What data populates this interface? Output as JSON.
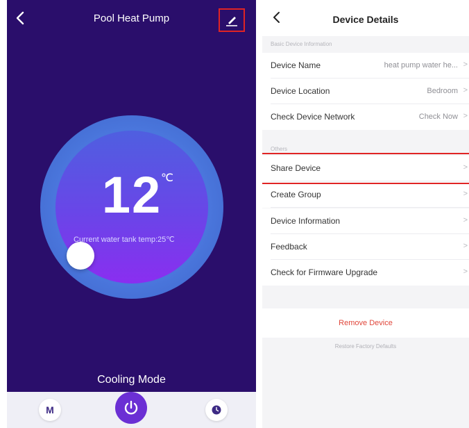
{
  "left": {
    "title": "Pool Heat Pump",
    "back_icon": "chevron-left-icon",
    "edit_icon": "pencil-icon",
    "temperature": "12",
    "unit": "℃",
    "current_temp_text": "Current water tank temp:25℃",
    "mode": "Cooling Mode",
    "mode_button_label": "M",
    "colors": {
      "background": "#2a0e6b",
      "dial_ring": "#4a76dc",
      "accent": "#6b2fd4",
      "highlight": "#e02424"
    }
  },
  "right": {
    "title": "Device Details",
    "section_basic": "Basic Device Information",
    "rows_basic": [
      {
        "label": "Device Name",
        "value": "heat pump water he..."
      },
      {
        "label": "Device Location",
        "value": "Bedroom"
      },
      {
        "label": "Check Device Network",
        "value": "Check Now"
      }
    ],
    "section_others": "Others",
    "rows_others": [
      {
        "label": "Share Device"
      },
      {
        "label": "Create Group"
      },
      {
        "label": "Device Information"
      },
      {
        "label": "Feedback"
      },
      {
        "label": "Check for Firmware Upgrade"
      }
    ],
    "remove_label": "Remove Device",
    "restore_label": "Restore Factory Defaults",
    "chevron": ">"
  }
}
